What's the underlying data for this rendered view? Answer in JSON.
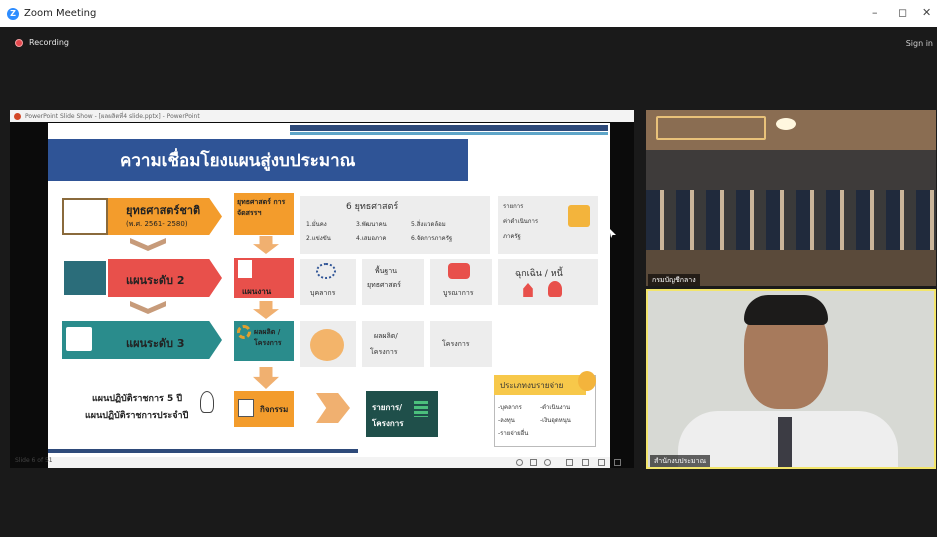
{
  "app": {
    "title": "Zoom Meeting",
    "signin": "Sign in",
    "recording": "Recording"
  },
  "ppt": {
    "window_title": "PowerPoint Slide Show - [ผลผลิตที่4 slide.pptx] - PowerPoint",
    "slide_counter": "Slide 6 of 51"
  },
  "slide": {
    "title": "ความเชื่อมโยงแผนสู่งบประมาณ",
    "row1": {
      "label": "ยุทธศาสตร์ชาติ",
      "sub": "(พ.ศ. 2561- 2580)",
      "middle": "ยุทธศาสตร์ การจัดสรรฯ",
      "strategy_head": "6 ยุทธศาสตร์",
      "s1": "1.มั่นคง",
      "s2": "2.แข่งขัน",
      "s3": "3.พัฒนาคน",
      "s4": "4.เสมอภาค",
      "s5": "5.สิ่งแวดล้อม",
      "s6": "6.จัดการภาครัฐ",
      "right1": "รายการ",
      "right2": "ค่าดำเนินการ",
      "right3": "ภาครัฐ"
    },
    "row2": {
      "label": "แผนระดับ 2",
      "middle": "แผนงาน",
      "c1": "บุคลากร",
      "c2": "พื้นฐาน",
      "c3": "ยุทธศาสตร์",
      "c4": "บูรณาการ",
      "emergency": "ฉุกเฉิน / หนี้"
    },
    "row3": {
      "label": "แผนระดับ 3",
      "middle": "ผลผลิต /โครงการ",
      "c1": "ผลผลิต/",
      "c2": "โครงการ",
      "c3": "โครงการ"
    },
    "row4": {
      "label1": "แผนปฏิบัติราชการ 5 ปี",
      "label2": "แผนปฏิบัติราชการประจำปี",
      "middle": "กิจกรรม",
      "item": "รายการ/",
      "item2": "โครงการ",
      "expense_head": "ประเภทงบรายจ่าย",
      "e1": "-บุคลากร",
      "e2": "-ดำเนินงาน",
      "e3": "-ลงทุน",
      "e4": "-เงินอุดหนุน",
      "e5": "-รายจ่ายอื่น"
    }
  },
  "participants": [
    {
      "name": "กรมบัญชีกลาง"
    },
    {
      "name": "สำนักงบประมาณ"
    }
  ],
  "colors": {
    "orange": "#f39c2c",
    "red": "#e8504b",
    "teal": "#2a8c8c",
    "navy": "#2f5496",
    "zoomblue": "#2d8cff"
  }
}
